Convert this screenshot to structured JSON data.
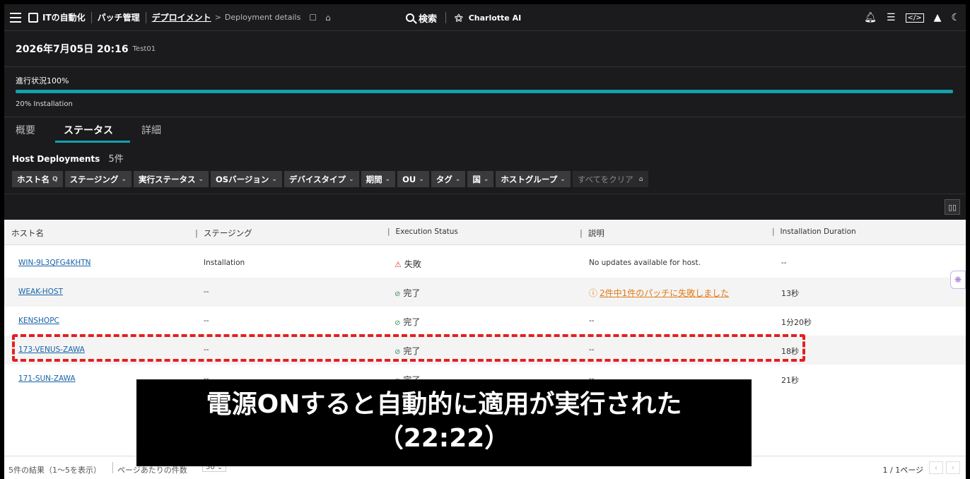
{
  "topbar": {
    "app_name": "ITの自動化",
    "crumb_patch": "パッチ管理",
    "crumb_deploy": "デプロイメント",
    "crumb_details": "Deployment details",
    "search_label": "検索",
    "ai_label": "Charlotte AI"
  },
  "header": {
    "title": "2026年7月05日 20:16",
    "subtitle": "Test01"
  },
  "progress": {
    "label": "進行状況100%",
    "value_percent": 100,
    "sub_label": "20% Installation"
  },
  "tabs": [
    "概要",
    "ステータス",
    "詳細"
  ],
  "host_deployments": {
    "title": "Host Deployments",
    "count": "5件"
  },
  "filters": [
    {
      "label": "ホスト名",
      "suffix": "Q"
    },
    {
      "label": "ステージング",
      "suffix": "⌄"
    },
    {
      "label": "実行ステータス",
      "suffix": "⌄"
    },
    {
      "label": "OSバージョン",
      "suffix": "⌄"
    },
    {
      "label": "デバイスタイプ",
      "suffix": "⌄"
    },
    {
      "label": "期間",
      "suffix": "⌄"
    },
    {
      "label": "OU",
      "suffix": "⌄"
    },
    {
      "label": "タグ",
      "suffix": "⌄"
    },
    {
      "label": "国",
      "suffix": "⌄"
    },
    {
      "label": "ホストグループ",
      "suffix": "⌄"
    }
  ],
  "clear_all": "すべてをクリア",
  "table": {
    "columns": [
      "ホスト名",
      "ステージング",
      "Execution Status",
      "説明",
      "Installation Duration"
    ],
    "rows": [
      {
        "host": "WIN-9L3QFG4KHTN",
        "staging": "Installation",
        "status": "失敗",
        "description": "No updates available for host.",
        "duration": "--"
      },
      {
        "host": "WEAK-HOST",
        "staging": "--",
        "status": "完了",
        "description": "2件中1件のパッチに失敗しました",
        "duration": "13秒"
      },
      {
        "host": "KENSHOPC",
        "staging": "--",
        "status": "完了",
        "description": "--",
        "duration": "1分20秒"
      },
      {
        "host": "173-VENUS-ZAWA",
        "staging": "--",
        "status": "完了",
        "description": "--",
        "duration": "18秒"
      },
      {
        "host": "171-SUN-ZAWA",
        "staging": "--",
        "status": "完了",
        "description": "--",
        "duration": "21秒"
      }
    ]
  },
  "footer": {
    "results": "5件の結果（1〜5を表示）",
    "per_page_label": "ページあたりの件数",
    "per_page_value": "50",
    "pages": "1 / 1ページ"
  },
  "caption": {
    "line1": "電源ONすると自動的に適用が実行された",
    "line2": "（22:22）"
  },
  "colors": {
    "accent": "#14a0ad",
    "highlight": "#e41f1f",
    "warning_link": "#e07a14"
  }
}
